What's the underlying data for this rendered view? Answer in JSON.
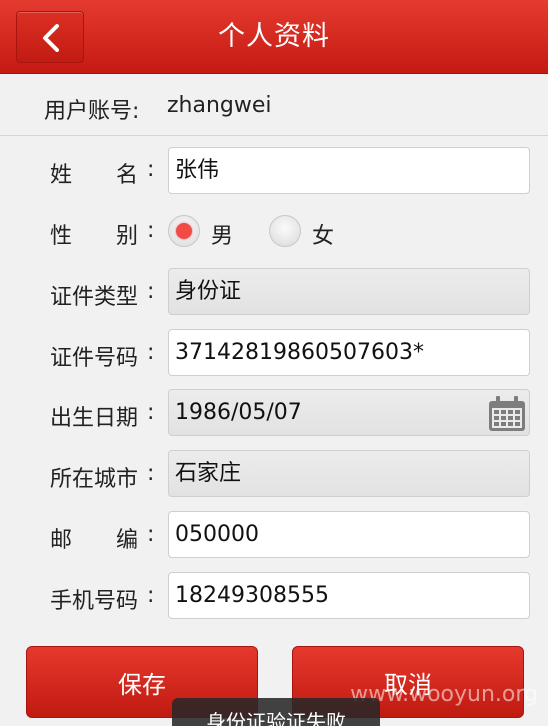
{
  "header": {
    "title": "个人资料",
    "back_icon": "chevron-left-icon"
  },
  "account": {
    "label": "用户账号:",
    "value": "zhangwei"
  },
  "form": {
    "name": {
      "label": "姓　　名",
      "value": "张伟"
    },
    "gender": {
      "label": "性　　别",
      "male": "男",
      "female": "女",
      "selected": "男"
    },
    "id_type": {
      "label": "证件类型",
      "value": "身份证"
    },
    "id_number": {
      "label": "证件号码",
      "value": "37142819860507603*"
    },
    "birth_date": {
      "label": "出生日期",
      "value": "1986/05/07",
      "icon": "calendar-icon"
    },
    "city": {
      "label": "所在城市",
      "value": "石家庄"
    },
    "postcode": {
      "label": "邮　　编",
      "value": "050000"
    },
    "phone": {
      "label": "手机号码",
      "value": "18249308555"
    },
    "colon": ":"
  },
  "buttons": {
    "save": "保存",
    "cancel": "取消"
  },
  "toast": "身份证验证失败",
  "watermark": "www.wooyun.org",
  "colors": {
    "accent": "#d4271d",
    "radio_selected": "#f24b45"
  }
}
